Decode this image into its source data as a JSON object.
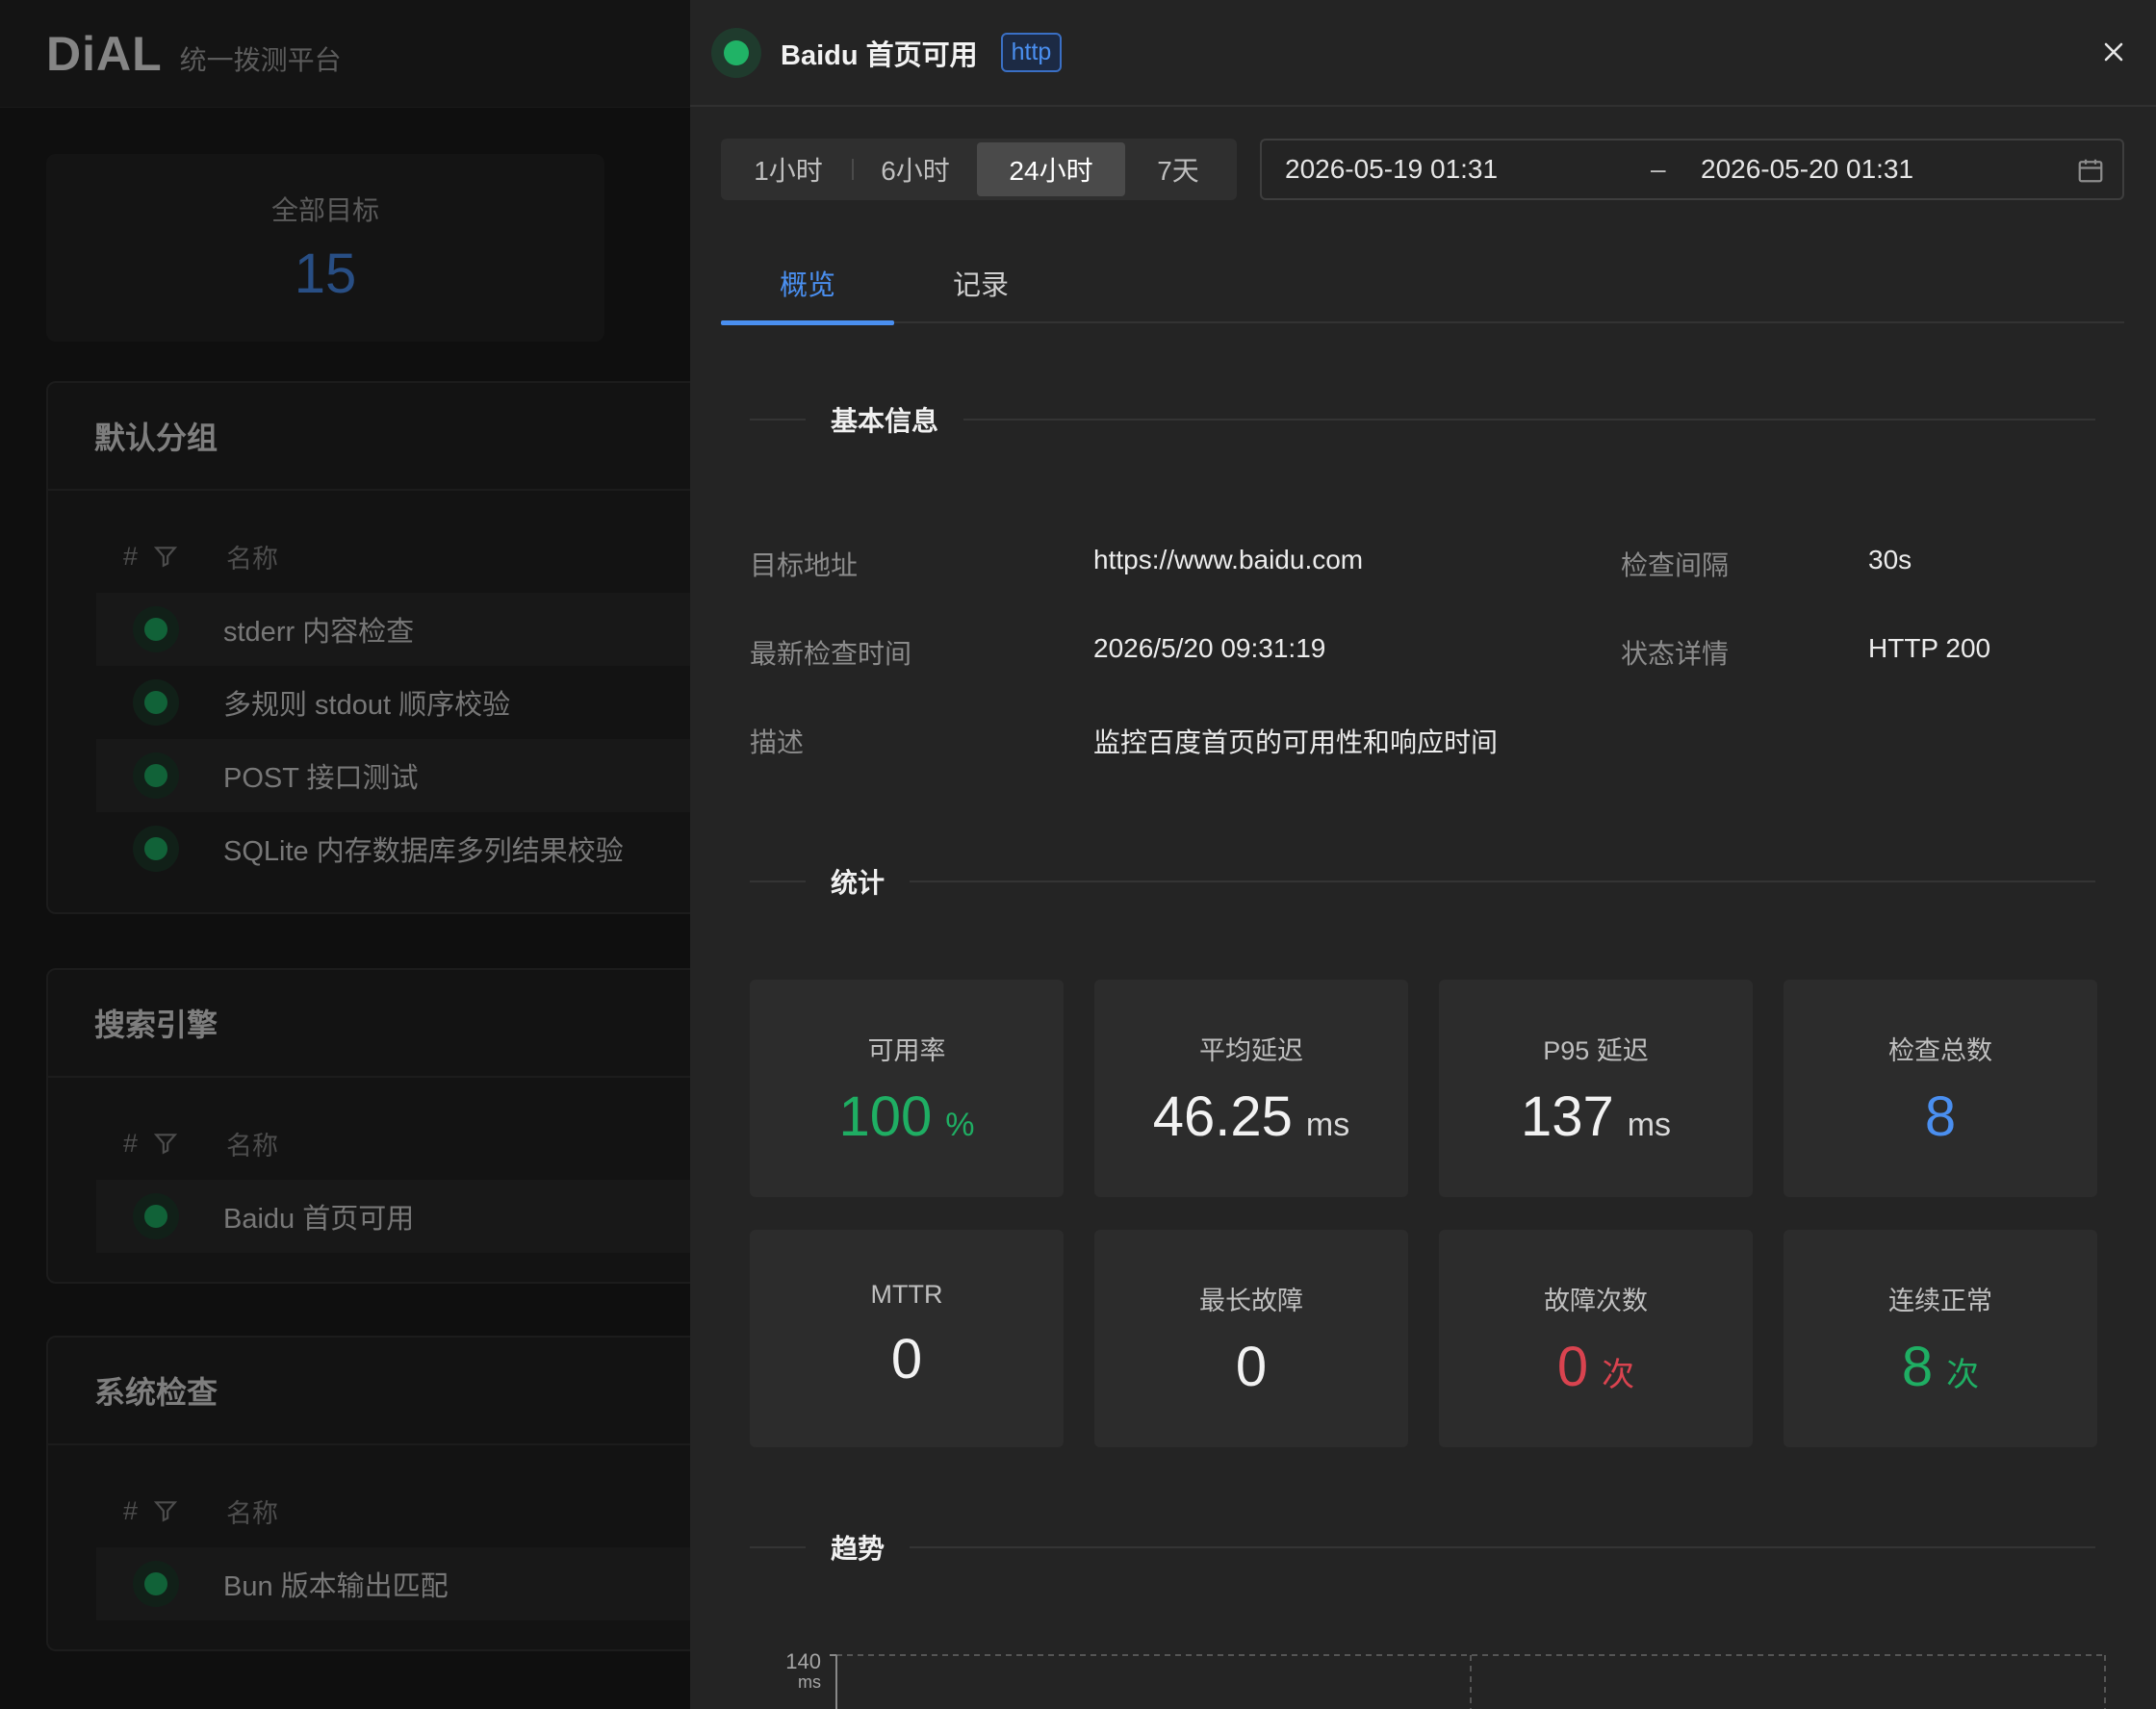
{
  "app": {
    "logo": "DiAL",
    "subtitle": "统一拨测平台"
  },
  "summary": {
    "total_label": "全部目标",
    "total_value": "15"
  },
  "groups": [
    {
      "name": "默认分组",
      "col_index": "#",
      "col_name": "名称",
      "rows": [
        "stderr 内容检查",
        "多规则 stdout 顺序校验",
        "POST 接口测试",
        "SQLite 内存数据库多列结果校验"
      ]
    },
    {
      "name": "搜索引擎",
      "col_index": "#",
      "col_name": "名称",
      "rows": [
        "Baidu 首页可用"
      ]
    },
    {
      "name": "系统检查",
      "col_index": "#",
      "col_name": "名称",
      "rows": [
        "Bun 版本输出匹配"
      ]
    }
  ],
  "drawer": {
    "title": "Baidu 首页可用",
    "tag": "http",
    "status_color": "#20b366",
    "ranges": [
      "1小时",
      "6小时",
      "24小时",
      "7天"
    ],
    "active_range": "24小时",
    "date_start": "2026-05-19 01:31",
    "date_sep": "–",
    "date_end": "2026-05-20 01:31",
    "tabs": [
      "概览",
      "记录"
    ],
    "active_tab": "概览",
    "sections": {
      "basic": "基本信息",
      "stats": "统计",
      "trend": "趋势"
    },
    "info": {
      "target_label": "目标地址",
      "target_value": "https://www.baidu.com",
      "interval_label": "检查间隔",
      "interval_value": "30s",
      "last_check_label": "最新检查时间",
      "last_check_value": "2026/5/20 09:31:19",
      "status_label": "状态详情",
      "status_value": "HTTP 200",
      "desc_label": "描述",
      "desc_value": "监控百度首页的可用性和响应时间"
    },
    "stats": [
      {
        "label": "可用率",
        "value": "100",
        "unit": "%"
      },
      {
        "label": "平均延迟",
        "value": "46.25",
        "unit": "ms"
      },
      {
        "label": "P95 延迟",
        "value": "137",
        "unit": "ms"
      },
      {
        "label": "检查总数",
        "value": "8",
        "unit": ""
      },
      {
        "label": "MTTR",
        "value": "0",
        "unit": ""
      },
      {
        "label": "最长故障",
        "value": "0",
        "unit": ""
      },
      {
        "label": "故障次数",
        "value": "0",
        "unit": "次"
      },
      {
        "label": "连续正常",
        "value": "8",
        "unit": "次"
      }
    ],
    "trend": {
      "y_max_label": "140",
      "y_unit": "ms"
    }
  },
  "colors": {
    "accent": "#4a8ff0",
    "success": "#1fae63",
    "danger": "#d9434f"
  }
}
